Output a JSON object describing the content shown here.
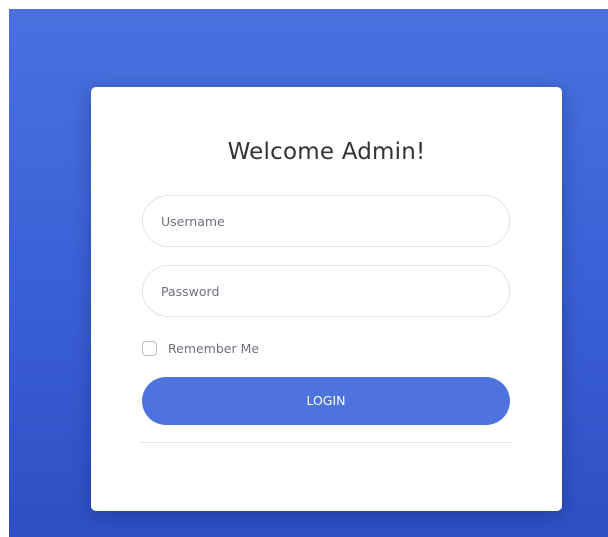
{
  "login_card": {
    "title": "Welcome Admin!",
    "username_placeholder": "Username",
    "password_placeholder": "Password",
    "remember_label": "Remember Me",
    "remember_checked": false,
    "login_label": "LOGIN"
  },
  "colors": {
    "background_gradient_top": "#4a71de",
    "background_gradient_bottom": "#2f4fc3",
    "button": "#4e73df",
    "card": "#ffffff"
  }
}
